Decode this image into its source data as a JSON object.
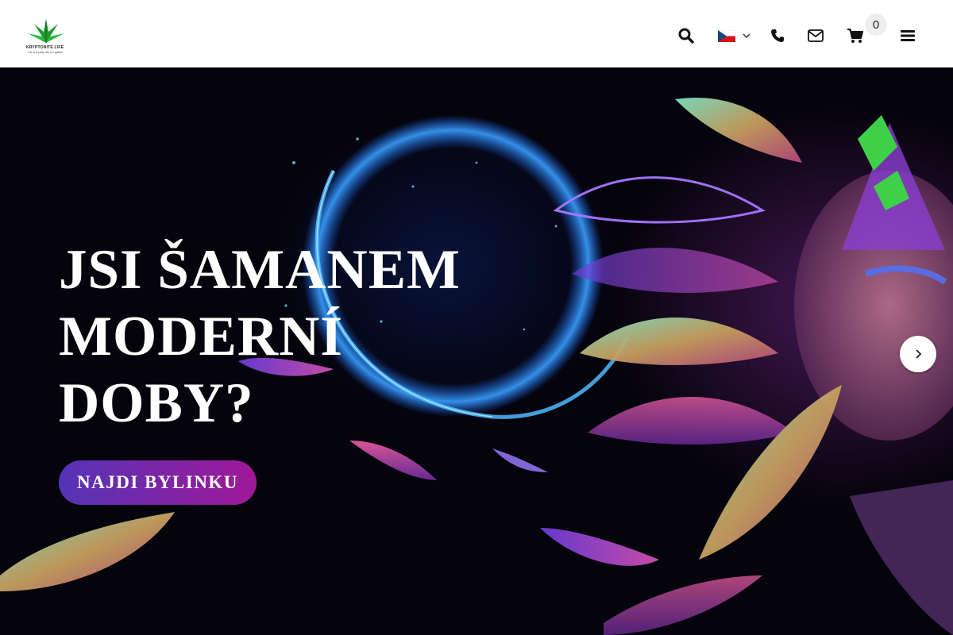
{
  "header": {
    "logo_alt": "Kryptonite Life",
    "logo_text": "KRYPTONITE LIFE",
    "logo_tagline": "Life is a party, life is a game!",
    "language": "CZ",
    "cart_count": "0",
    "icons": [
      "search-icon",
      "flag-cz-icon",
      "chevron-down-icon",
      "phone-icon",
      "envelope-icon",
      "cart-icon",
      "menu-icon"
    ]
  },
  "hero": {
    "title_line1": "JSI ŠAMANEM",
    "title_line2": "MODERNÍ",
    "title_line3": "DOBY?",
    "cta_label": "NAJDI BYLINKU",
    "next_icon": "chevron-right-icon"
  },
  "colors": {
    "accent_start": "#5434b6",
    "accent_end": "#a01898",
    "header_bg": "#ffffff",
    "hero_bg": "#05030c"
  }
}
